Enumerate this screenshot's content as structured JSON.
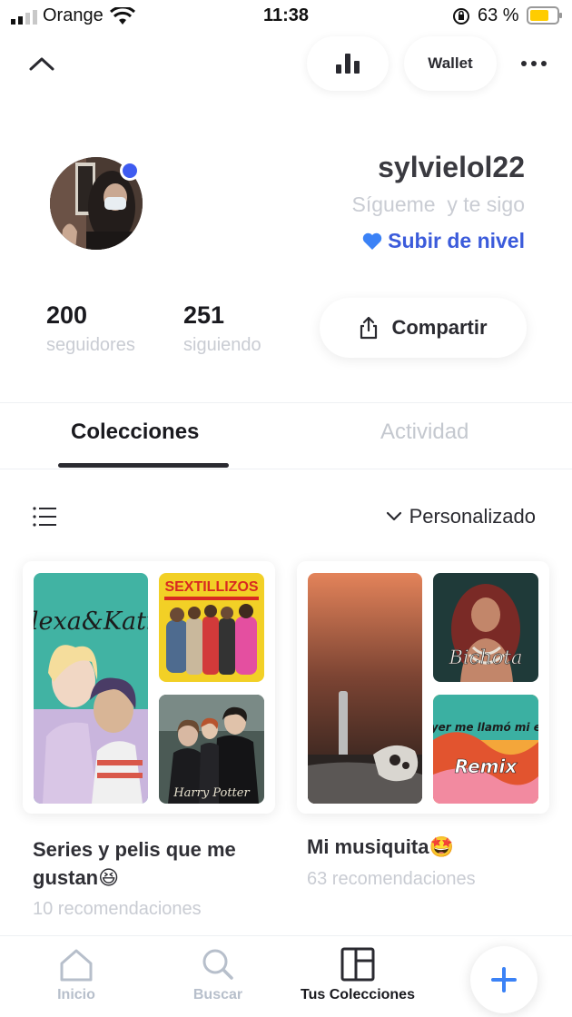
{
  "status_bar": {
    "carrier": "Orange",
    "time": "11:38",
    "battery_percent": "63 %"
  },
  "top_bar": {
    "wallet_label": "Wallet"
  },
  "profile": {
    "username": "sylvielol22",
    "bio": "Sígueme  y te sigo",
    "level_label": "Subir de nivel",
    "followers_count": "200",
    "followers_label": "seguidores",
    "following_count": "251",
    "following_label": "siguiendo",
    "share_label": "Compartir"
  },
  "tabs": [
    {
      "label": "Colecciones",
      "active": true
    },
    {
      "label": "Actividad",
      "active": false
    }
  ],
  "controls": {
    "sort_label": "Personalizado"
  },
  "collections": [
    {
      "title": "Series y pelis que me gustan😆",
      "subtitle": "10 recomendaciones"
    },
    {
      "title": "Mi musiquita🤩",
      "subtitle": "63 recomendaciones"
    }
  ],
  "artwork_text": {
    "alexa_katie": "Alexa&Katie",
    "sextillizos": "SEXTILLIZOS",
    "harry_potter": "Harry Potter",
    "bichota": "Bichota",
    "ayer_me_llamo": "Ayer me llamó mi ex",
    "remix": "Remix"
  },
  "bottom_nav": {
    "home_label": "Inicio",
    "search_label": "Buscar",
    "collections_label": "Tus Colecciones"
  },
  "colors": {
    "accent_blue": "#3b5bdb",
    "online_dot": "#3e5bf0",
    "muted_text": "#c9ccd3",
    "fab_plus": "#3b82f6",
    "battery_yellow": "#ffcc00"
  }
}
